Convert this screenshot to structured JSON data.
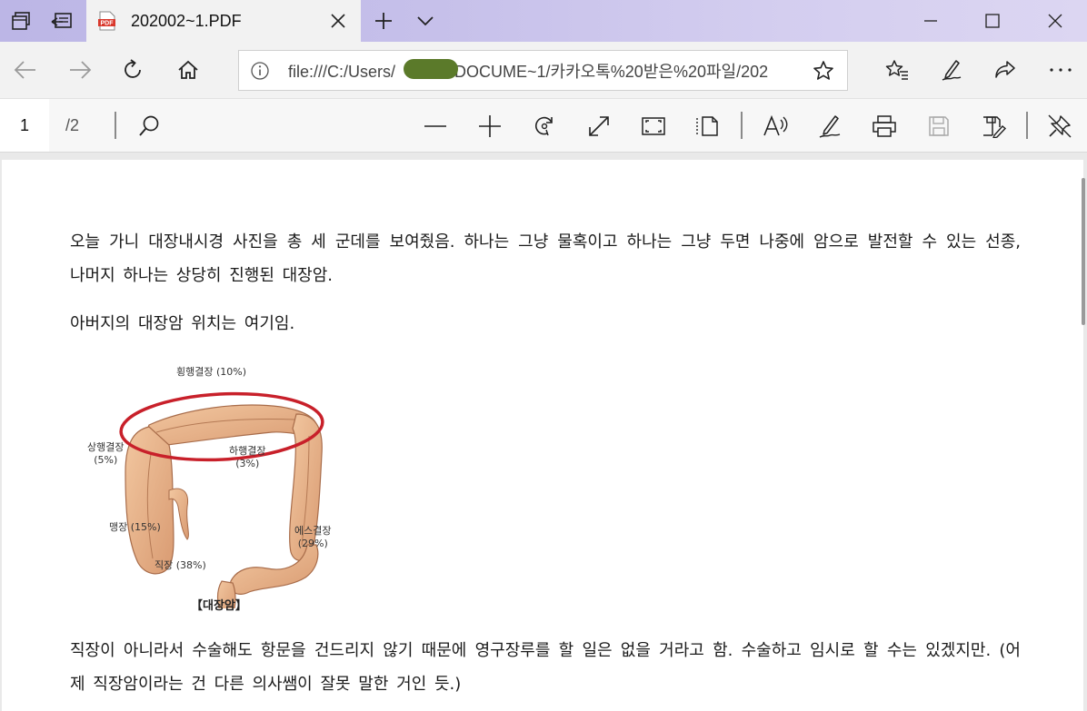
{
  "tab": {
    "title": "202002~1.PDF",
    "file_type_badge": "PDF"
  },
  "address": {
    "url_before": "file:///C:/Users/",
    "url_after": "/DOCUME~1/카카오톡%20받은%20파일/202"
  },
  "pdf_toolbar": {
    "current_page": "1",
    "total_pages": "/2"
  },
  "document": {
    "paragraph1": "오늘 가니 대장내시경 사진을 총 세 군데를 보여줬음. 하나는 그냥 물혹이고 하나는 그냥 두면 나중에 암으로 발전할 수 있는 선종, 나머지 하나는 상당히 진행된 대장암.",
    "paragraph2": "아버지의 대장암 위치는 여기임.",
    "figure": {
      "transverse": "횡행결장 (10%)",
      "ascending_name": "상행결장",
      "ascending_pct": "(5%)",
      "descending_name": "하행결장",
      "descending_pct": "(3%)",
      "cecum": "맹장 (15%)",
      "sigmoid_name": "에스결장",
      "sigmoid_pct": "(29%)",
      "rectum": "직장 (38%)",
      "caption": "【대장암】"
    },
    "paragraph3": "직장이 아니라서 수술해도 항문을 건드리지 않기 때문에 영구장루를 할 일은 없을 거라고 함. 수술하고 임시로 할 수는 있겠지만. (어제 직장암이라는 건 다른 의사쌤이 잘못 말한 거인 듯.)"
  },
  "colors": {
    "tabbar": "#c6c0ea",
    "chrome": "#f2f2f2",
    "pdf_badge": "#d9382c",
    "highlight_circle": "#c8202a",
    "colon": "#e8b48a"
  },
  "icons": {
    "tab_actions": [
      "tabs-aside-icon",
      "restore-tabs-icon"
    ],
    "nav": [
      "back-icon",
      "forward-icon",
      "refresh-icon",
      "home-icon"
    ],
    "url": [
      "info-icon",
      "favorite-star-icon"
    ],
    "browser_actions": [
      "favorites-icon",
      "notes-pen-icon",
      "share-icon",
      "more-icon"
    ],
    "pdf_tools": [
      "search-icon",
      "zoom-out-icon",
      "zoom-in-icon",
      "rotate-icon",
      "fit-width-icon",
      "fit-page-icon",
      "page-view-icon",
      "read-aloud-icon",
      "draw-icon",
      "print-icon",
      "save-icon",
      "save-as-icon",
      "pin-toolbar-icon"
    ]
  }
}
